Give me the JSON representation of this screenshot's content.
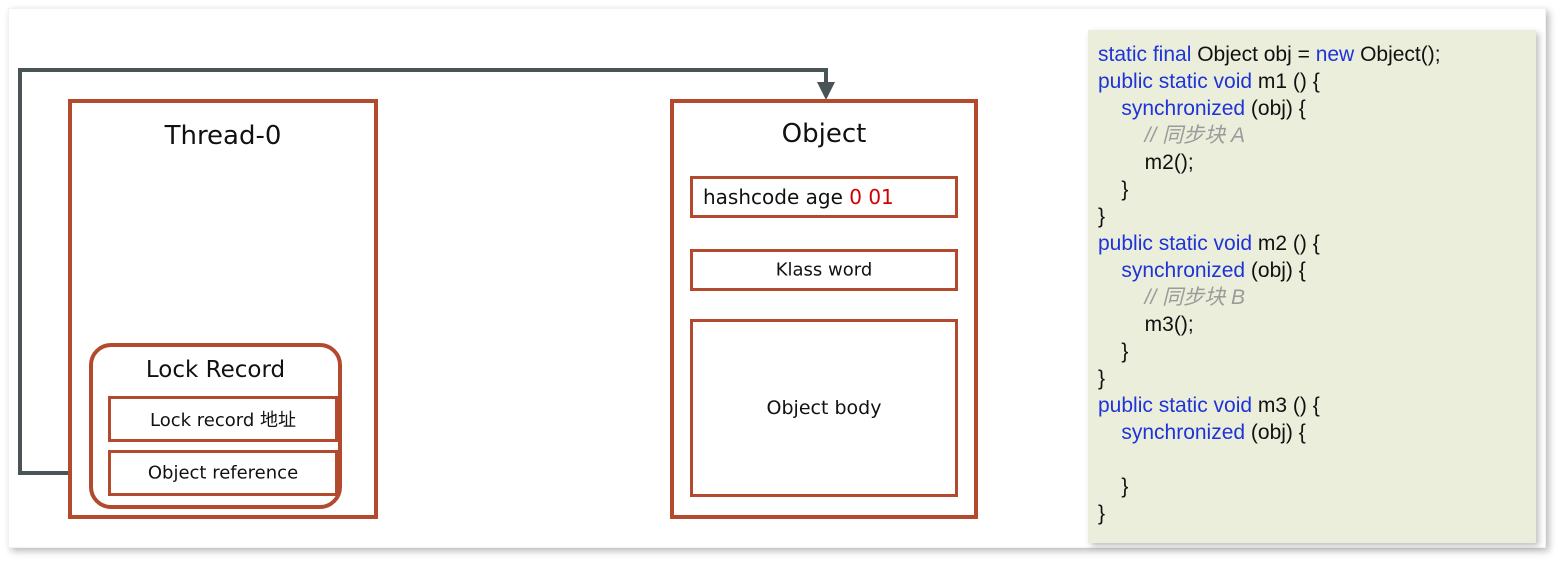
{
  "diagram": {
    "thread_box": {
      "title": "Thread-0",
      "lock_record": {
        "title": "Lock Record",
        "rows": [
          {
            "label": "Lock record 地址"
          },
          {
            "label": "Object reference"
          }
        ]
      }
    },
    "object_box": {
      "title": "Object",
      "mark_word": {
        "text": "hashcode age ",
        "bits": "0 01"
      },
      "klass_word": {
        "label": "Klass word"
      },
      "object_body": {
        "label": "Object body"
      }
    },
    "connector": {
      "name": "object-reference-arrow",
      "from": "Object reference",
      "to": "Object",
      "color": "#4A5356"
    },
    "colors": {
      "box_border": "#B34A2E",
      "accent_red": "#D00000",
      "connector": "#4A5356",
      "code_bg": "#EAEEDB",
      "code_keyword": "#1F34D8",
      "code_comment": "#9B9B9B"
    }
  },
  "code": {
    "lines": [
      {
        "segments": [
          {
            "t": "static final",
            "c": "kw"
          },
          {
            "t": " Object obj = ",
            "c": ""
          },
          {
            "t": "new",
            "c": "kw"
          },
          {
            "t": " Object();",
            "c": ""
          }
        ]
      },
      {
        "segments": [
          {
            "t": "public static void",
            "c": "kw"
          },
          {
            "t": " m1 () {",
            "c": ""
          }
        ]
      },
      {
        "segments": [
          {
            "t": "    ",
            "c": ""
          },
          {
            "t": "synchronized",
            "c": "kw"
          },
          {
            "t": " (obj) {",
            "c": ""
          }
        ]
      },
      {
        "segments": [
          {
            "t": "        // 同步块 A",
            "c": "cmt"
          }
        ]
      },
      {
        "segments": [
          {
            "t": "        m2();",
            "c": ""
          }
        ]
      },
      {
        "segments": [
          {
            "t": "    }",
            "c": ""
          }
        ]
      },
      {
        "segments": [
          {
            "t": "}",
            "c": ""
          }
        ]
      },
      {
        "segments": [
          {
            "t": "public static void",
            "c": "kw"
          },
          {
            "t": " m2 () {",
            "c": ""
          }
        ]
      },
      {
        "segments": [
          {
            "t": "    ",
            "c": ""
          },
          {
            "t": "synchronized",
            "c": "kw"
          },
          {
            "t": " (obj) {",
            "c": ""
          }
        ]
      },
      {
        "segments": [
          {
            "t": "        // 同步块 B",
            "c": "cmt"
          }
        ]
      },
      {
        "segments": [
          {
            "t": "        m3();",
            "c": ""
          }
        ]
      },
      {
        "segments": [
          {
            "t": "    }",
            "c": ""
          }
        ]
      },
      {
        "segments": [
          {
            "t": "}",
            "c": ""
          }
        ]
      },
      {
        "segments": [
          {
            "t": "public static void",
            "c": "kw"
          },
          {
            "t": " m3 () {",
            "c": ""
          }
        ]
      },
      {
        "segments": [
          {
            "t": "    ",
            "c": ""
          },
          {
            "t": "synchronized",
            "c": "kw"
          },
          {
            "t": " (obj) {",
            "c": ""
          }
        ]
      },
      {
        "segments": [
          {
            "t": "",
            "c": ""
          }
        ]
      },
      {
        "segments": [
          {
            "t": "    }",
            "c": ""
          }
        ]
      },
      {
        "segments": [
          {
            "t": "}",
            "c": ""
          }
        ]
      }
    ]
  }
}
